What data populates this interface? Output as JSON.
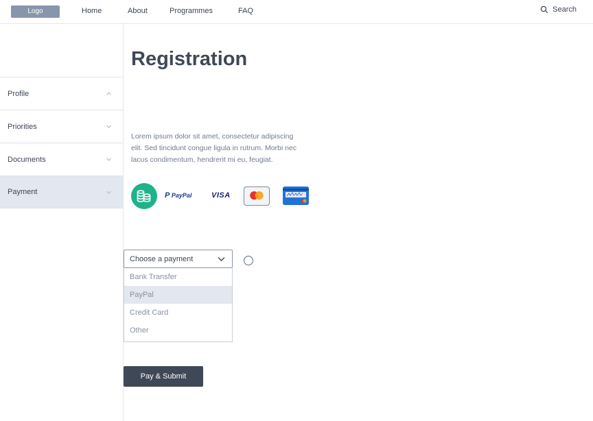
{
  "header": {
    "logo": "Logo",
    "nav": [
      "Home",
      "About",
      "Programmes",
      "FAQ"
    ],
    "search_label": "Search"
  },
  "sidebar": {
    "items": [
      {
        "label": "Profile",
        "expanded": true
      },
      {
        "label": "Priorities",
        "expanded": false
      },
      {
        "label": "Documents",
        "expanded": false
      },
      {
        "label": "Payment",
        "expanded": false,
        "active": true
      }
    ]
  },
  "main": {
    "title": "Registration",
    "description": "Lorem ipsum dolor sit amet, consectetur adipiscing elit. Sed tincidunt congue ligula in rutrum. Morbi nec lacus condimentum, hendrerit mi eu, feugiat.",
    "payment_icons": [
      "bank-transfer-coins-icon",
      "paypal-logo",
      "visa-logo",
      "mastercard-logo",
      "credit-card-icon"
    ],
    "paypal_text": "PayPal",
    "visa_text": "VISA",
    "select": {
      "placeholder": "Choose a payment",
      "options": [
        "Bank Transfer",
        "PayPal",
        "Credit Card",
        "Other"
      ],
      "highlighted": "PayPal"
    },
    "submit_label": "Pay & Submit"
  },
  "colors": {
    "accent_dark": "#3f4856",
    "active_bg": "#e2e7f0",
    "logo_bg": "#8896ab",
    "coins_green": "#1fb38a"
  }
}
